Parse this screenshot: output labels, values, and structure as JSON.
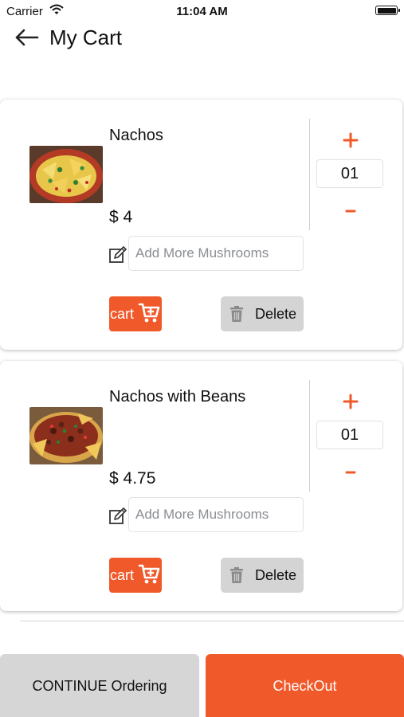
{
  "status_bar": {
    "carrier": "Carrier",
    "time": "11:04 AM"
  },
  "header": {
    "title": "My Cart",
    "back_icon": "arrow-left-icon"
  },
  "theme": {
    "accent": "#f0592a",
    "secondary_button": "#d4d4d4"
  },
  "cart_items": [
    {
      "name": "Nachos",
      "price": "$ 4",
      "quantity": "01",
      "note_placeholder": "Add More Mushrooms",
      "cart_label": "cart",
      "delete_label": "Delete"
    },
    {
      "name": "Nachos with Beans",
      "price": "$ 4.75",
      "quantity": "01",
      "note_placeholder": "Add More Mushrooms",
      "cart_label": "cart",
      "delete_label": "Delete"
    }
  ],
  "footer": {
    "continue_label": "CONTINUE Ordering",
    "checkout_label": "CheckOut"
  }
}
